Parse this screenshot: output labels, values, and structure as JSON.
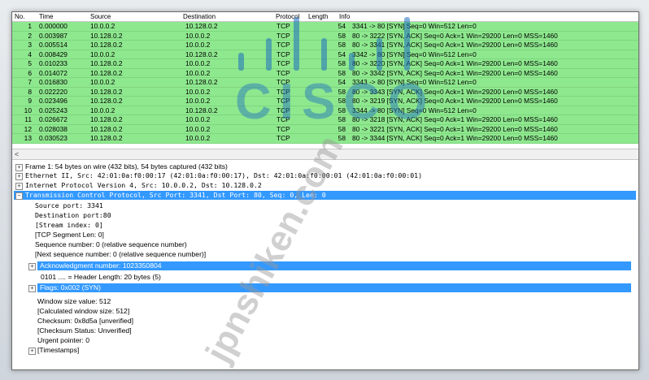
{
  "columns": {
    "no": "No.",
    "time": "Time",
    "source": "Source",
    "destination": "Destination",
    "protocol": "Protocol",
    "length": "Length",
    "info": "Info"
  },
  "packets": [
    {
      "no": "1",
      "time": "0.000000",
      "src": "10.0.0.2",
      "dst": "10.128.0.2",
      "proto": "TCP",
      "len": "54",
      "info": "3341 -> 80  [SYN]  Seq=0  Win=512  Len=0"
    },
    {
      "no": "2",
      "time": "0.003987",
      "src": "10.128.0.2",
      "dst": "10.0.0.2",
      "proto": "TCP",
      "len": "58",
      "info": "80 -> 3222  [SYN, ACK]  Seq=0  Ack=1  Win=29200  Len=0  MSS=1460"
    },
    {
      "no": "3",
      "time": "0.005514",
      "src": "10.128.0.2",
      "dst": "10.0.0.2",
      "proto": "TCP",
      "len": "58",
      "info": "80 -> 3341  [SYN, ACK]  Seq=0  Ack=1  Win=29200  Len=0  MSS=1460"
    },
    {
      "no": "4",
      "time": "0.008429",
      "src": "10.0.0.2",
      "dst": "10.128.0.2",
      "proto": "TCP",
      "len": "54",
      "info": "3342 -> 80  [SYN]  Seq=0  Win=512  Len=0"
    },
    {
      "no": "5",
      "time": "0.010233",
      "src": "10.128.0.2",
      "dst": "10.0.0.2",
      "proto": "TCP",
      "len": "58",
      "info": "80 -> 3220  [SYN, ACK]  Seq=0  Ack=1  Win=29200  Len=0  MSS=1460"
    },
    {
      "no": "6",
      "time": "0.014072",
      "src": "10.128.0.2",
      "dst": "10.0.0.2",
      "proto": "TCP",
      "len": "58",
      "info": "80 -> 3342  [SYN, ACK]  Seq=0  Ack=1  Win=29200  Len=0  MSS=1460"
    },
    {
      "no": "7",
      "time": "0.016830",
      "src": "10.0.0.2",
      "dst": "10.128.0.2",
      "proto": "TCP",
      "len": "54",
      "info": "3343 -> 80  [SYN]  Seq=0  Win=512  Len=0"
    },
    {
      "no": "8",
      "time": "0.022220",
      "src": "10.128.0.2",
      "dst": "10.0.0.2",
      "proto": "TCP",
      "len": "58",
      "info": "80 -> 3343  [SYN, ACK]  Seq=0  Ack=1  Win=29200  Len=0  MSS=1460"
    },
    {
      "no": "9",
      "time": "0.023496",
      "src": "10.128.0.2",
      "dst": "10.0.0.2",
      "proto": "TCP",
      "len": "58",
      "info": "80 -> 3219  [SYN, ACK]  Seq=0  Ack=1  Win=29200  Len=0  MSS=1460"
    },
    {
      "no": "10",
      "time": "0.025243",
      "src": "10.0.0.2",
      "dst": "10.128.0.2",
      "proto": "TCP",
      "len": "58",
      "info": "3344 -> 80  [SYN]  Seq=0  Win=512  Len=0"
    },
    {
      "no": "11",
      "time": "0.026672",
      "src": "10.128.0.2",
      "dst": "10.0.0.2",
      "proto": "TCP",
      "len": "58",
      "info": "80 -> 3218  [SYN, ACK]  Seq=0  Ack=1  Win=29200  Len=0  MSS=1460"
    },
    {
      "no": "12",
      "time": "0.028038",
      "src": "10.128.0.2",
      "dst": "10.0.0.2",
      "proto": "TCP",
      "len": "58",
      "info": "80 -> 3221  [SYN, ACK]  Seq=0  Ack=1  Win=29200  Len=0  MSS=1460"
    },
    {
      "no": "13",
      "time": "0.030523",
      "src": "10.128.0.2",
      "dst": "10.0.0.2",
      "proto": "TCP",
      "len": "58",
      "info": "80 -> 3344  [SYN, ACK]  Seq=0  Ack=1  Win=29200  Len=0  MSS=1460"
    }
  ],
  "scroll": {
    "left_arrow": "<"
  },
  "details": {
    "frame": "Frame 1: 54 bytes on wire (432 bits), 54 bytes captured (432 bits)",
    "ethernet": "Ethernet II, Src: 42:01:0a:f0:00:17 (42:01:0a:f0:00:17), Dst: 42:01:0a:f0:00:01 (42:01:0a:f0:00:01)",
    "ip": "Internet Protocol Version 4, Src: 10.0.0.2, Dst: 10.128.0.2",
    "tcp": "Transmission Control Protocol, Src Port: 3341, Dst Port: 80, Seq: 0, Len: 0",
    "source_port": "Source port: 3341",
    "destination_port": "Destination port:80",
    "stream_index": "[Stream index: 0]",
    "segment_len": "[TCP Segment Len: 0]",
    "seq": "Sequence number: 0    (relative sequence number)",
    "next_seq": "[Next sequence number: 0   (relative sequence number)]",
    "ack": "Acknowledgment number: 1023350804",
    "header_len": "0101 .... = Header Length: 20 bytes (5)",
    "flags": "Flags: 0x002 (SYN)",
    "window": "Window size value: 512",
    "calc_window": "[Calculated window size: 512]",
    "checksum": "Checksum: 0x8d5a [unverified]",
    "checksum_status": "[Checksum Status: Unverified]",
    "urgent": "Urgent pointer: 0",
    "timestamps": "[Timestamps]"
  },
  "watermark": {
    "logo": "CISCO",
    "text": "jpnshiken.com"
  },
  "colors": {
    "row_green": "#8ee88e",
    "selection_blue": "#3399ff"
  }
}
